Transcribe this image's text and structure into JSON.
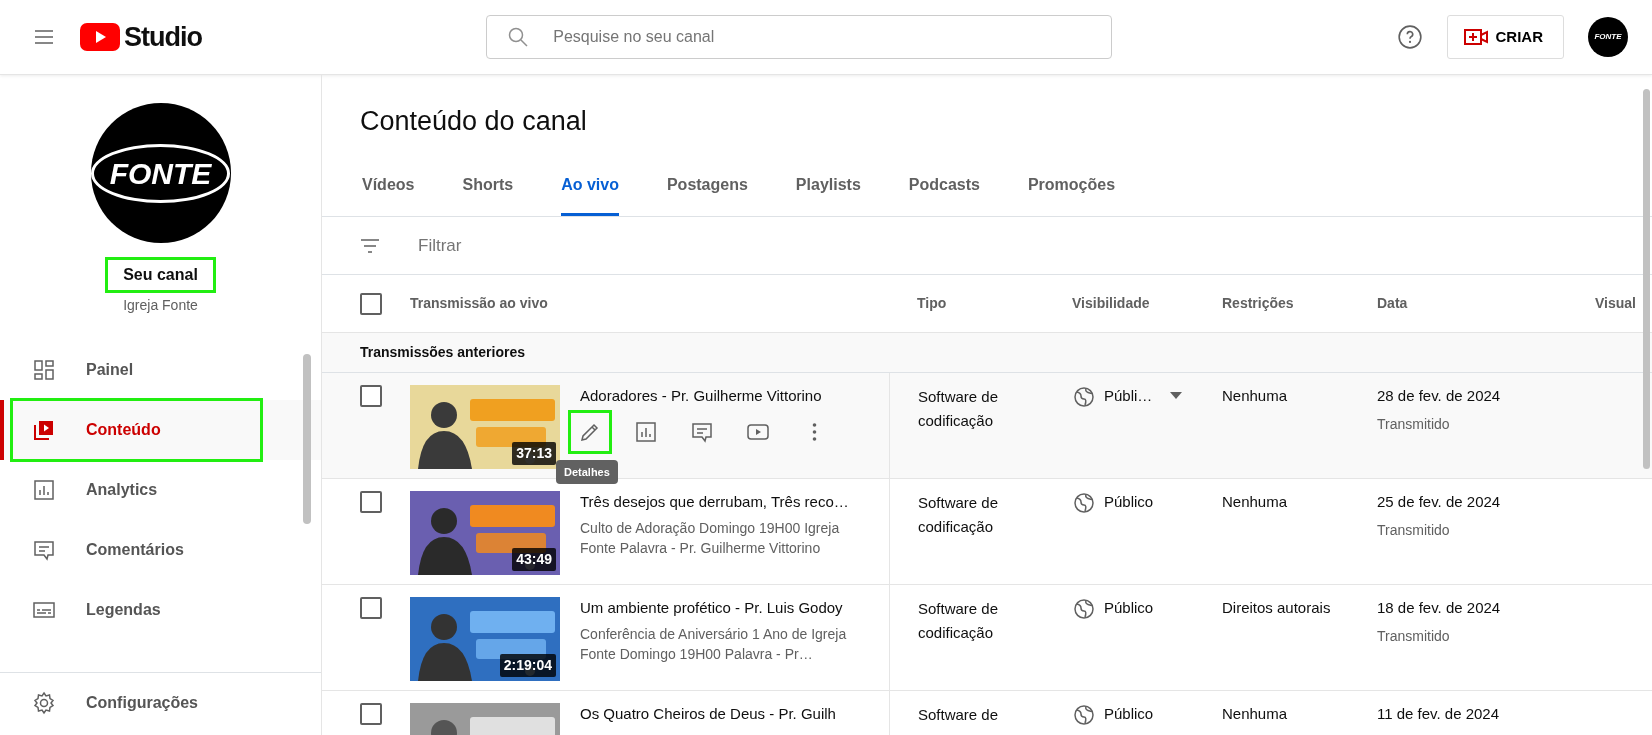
{
  "topbar": {
    "logo_text": "Studio",
    "search": {
      "placeholder": "Pesquise no seu canal"
    },
    "create_button": "CRIAR",
    "avatar_text": "FONTE"
  },
  "sidebar": {
    "avatar_text": "FONTE",
    "channel_label": "Seu canal",
    "channel_label_highlighted": true,
    "channel_name": "Igreja Fonte",
    "items": [
      {
        "label": "Painel",
        "kind": "dashboard",
        "selected": false,
        "highlighted": false
      },
      {
        "label": "Conteúdo",
        "kind": "content",
        "selected": true,
        "highlighted": true
      },
      {
        "label": "Analytics",
        "kind": "analytics",
        "selected": false,
        "highlighted": false
      },
      {
        "label": "Comentários",
        "kind": "comments",
        "selected": false,
        "highlighted": false
      },
      {
        "label": "Legendas",
        "kind": "subtitles",
        "selected": false,
        "highlighted": false
      }
    ],
    "footer_item": {
      "label": "Configurações",
      "kind": "settings"
    }
  },
  "page": {
    "title": "Conteúdo do canal",
    "tabs": [
      {
        "label": "Vídeos",
        "selected": false
      },
      {
        "label": "Shorts",
        "selected": false
      },
      {
        "label": "Ao vivo",
        "selected": true
      },
      {
        "label": "Postagens",
        "selected": false
      },
      {
        "label": "Playlists",
        "selected": false
      },
      {
        "label": "Podcasts",
        "selected": false
      },
      {
        "label": "Promoções",
        "selected": false
      }
    ],
    "filter": {
      "placeholder": "Filtrar"
    }
  },
  "table": {
    "columns": [
      "Transmissão ao vivo",
      "Tipo",
      "Visibilidade",
      "Restrições",
      "Data",
      "Visual"
    ],
    "select_all_checked": false,
    "section": "Transmissões anteriores",
    "rows": [
      {
        "title": "Adoradores - Pr. Guilherme Vittorino",
        "duration": "37:13",
        "type": "Software de codificação",
        "visibility": "Públi…",
        "visibility_dropdown": true,
        "restrictions": "Nenhuma",
        "date": "28 de fev. de 2024",
        "status": "Transmitido",
        "hovered": true,
        "checked": false,
        "actions": [
          {
            "kind": "edit",
            "highlighted": true,
            "tooltip": "Detalhes"
          },
          {
            "kind": "analytics",
            "highlighted": false
          },
          {
            "kind": "comments",
            "highlighted": false
          },
          {
            "kind": "play",
            "highlighted": false
          },
          {
            "kind": "more",
            "highlighted": false
          }
        ]
      },
      {
        "title": "Três desejos que derrubam, Três reco…",
        "description": "Culto de Adoração Domingo 19H00 Igreja Fonte Palavra - Pr. Guilherme Vittorino",
        "duration": "43:49",
        "type": "Software de codificação",
        "visibility": "Público",
        "visibility_dropdown": false,
        "restrictions": "Nenhuma",
        "date": "25 de fev. de 2024",
        "status": "Transmitido",
        "hovered": false,
        "checked": false
      },
      {
        "title": "Um ambiente profético - Pr. Luis Godoy",
        "description": "Conferência de Aniversário 1 Ano de Igreja Fonte Domingo 19H00 Palavra - Pr…",
        "duration": "2:19:04",
        "type": "Software de codificação",
        "visibility": "Público",
        "visibility_dropdown": false,
        "restrictions": "Direitos autorais",
        "date": "18 de fev. de 2024",
        "status": "Transmitido",
        "hovered": false,
        "checked": false
      },
      {
        "title": "Os Quatro Cheiros de Deus - Pr. Guilh",
        "type": "Software de",
        "visibility": "Público",
        "visibility_dropdown": false,
        "restrictions": "Nenhuma",
        "date": "11 de fev. de 2024",
        "hovered": false,
        "checked": false
      }
    ]
  }
}
